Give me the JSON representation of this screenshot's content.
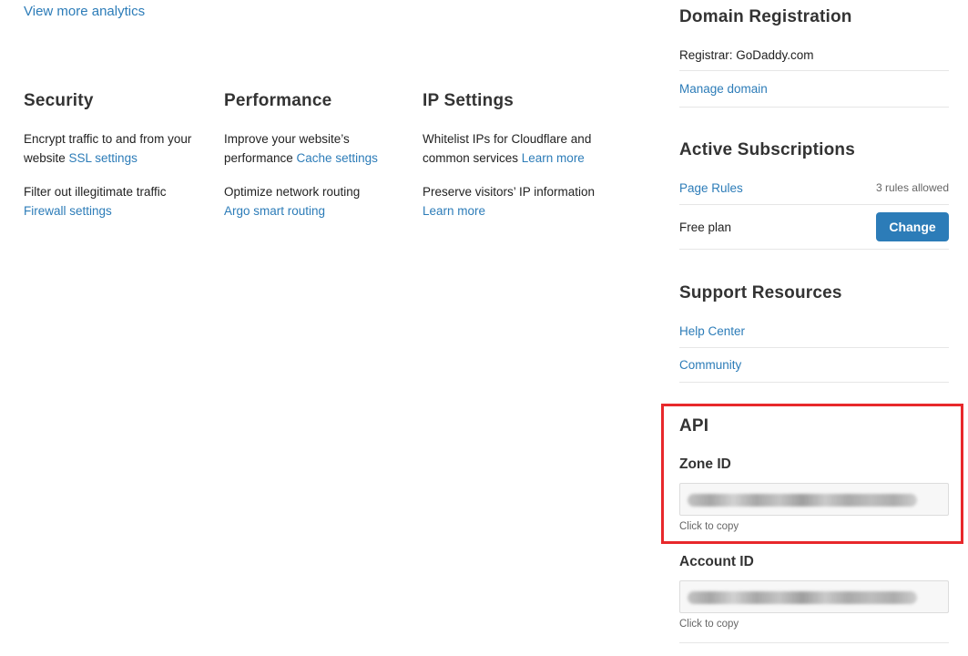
{
  "analytics": {
    "view_more": "View more analytics"
  },
  "features": {
    "security": {
      "title": "Security",
      "items": [
        {
          "text": "Encrypt traffic to and from your website ",
          "link": "SSL settings"
        },
        {
          "text": "Filter out illegitimate traffic ",
          "link": "Firewall settings"
        }
      ]
    },
    "performance": {
      "title": "Performance",
      "items": [
        {
          "text": "Improve your website’s performance ",
          "link": "Cache settings"
        },
        {
          "text": "Optimize network routing ",
          "link": "Argo smart routing"
        }
      ]
    },
    "ip_settings": {
      "title": "IP Settings",
      "items": [
        {
          "text": "Whitelist IPs for Cloudflare and common services ",
          "link": "Learn more"
        },
        {
          "text": "Preserve visitors’ IP information ",
          "link": "Learn more"
        }
      ]
    }
  },
  "sidebar": {
    "domain_registration": {
      "title": "Domain Registration",
      "registrar": "Registrar: GoDaddy.com",
      "manage_link": "Manage domain"
    },
    "subscriptions": {
      "title": "Active Subscriptions",
      "page_rules_link": "Page Rules",
      "page_rules_note": "3 rules allowed",
      "plan": "Free plan",
      "change_label": "Change"
    },
    "support": {
      "title": "Support Resources",
      "help_center": "Help Center",
      "community": "Community"
    },
    "api": {
      "title": "API",
      "zone_id_label": "Zone ID",
      "zone_hint": "Click to copy",
      "account_id_label": "Account ID",
      "account_hint": "Click to copy"
    }
  },
  "colors": {
    "link": "#2c7cb8",
    "button": "#2c7cb8",
    "highlight": "#e8282b"
  }
}
